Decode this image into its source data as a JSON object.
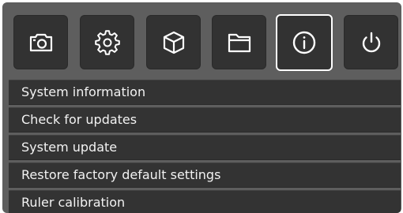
{
  "toolbar": {
    "buttons": [
      {
        "icon": "camera-icon",
        "active": false
      },
      {
        "icon": "gear-icon",
        "active": false
      },
      {
        "icon": "cube-icon",
        "active": false
      },
      {
        "icon": "folder-icon",
        "active": false
      },
      {
        "icon": "info-icon",
        "active": true
      },
      {
        "icon": "power-icon",
        "active": false
      }
    ]
  },
  "menu": {
    "items": [
      {
        "label": "System information"
      },
      {
        "label": "Check for updates"
      },
      {
        "label": "System update"
      },
      {
        "label": "Restore factory default settings"
      },
      {
        "label": "Ruler calibration"
      }
    ]
  },
  "colors": {
    "panel_background": "#5e5e5e",
    "button_background": "#323232",
    "active_border": "#ffffff",
    "menu_item_background": "#333333",
    "text": "#f2f2f2",
    "icon": "#ffffff"
  }
}
